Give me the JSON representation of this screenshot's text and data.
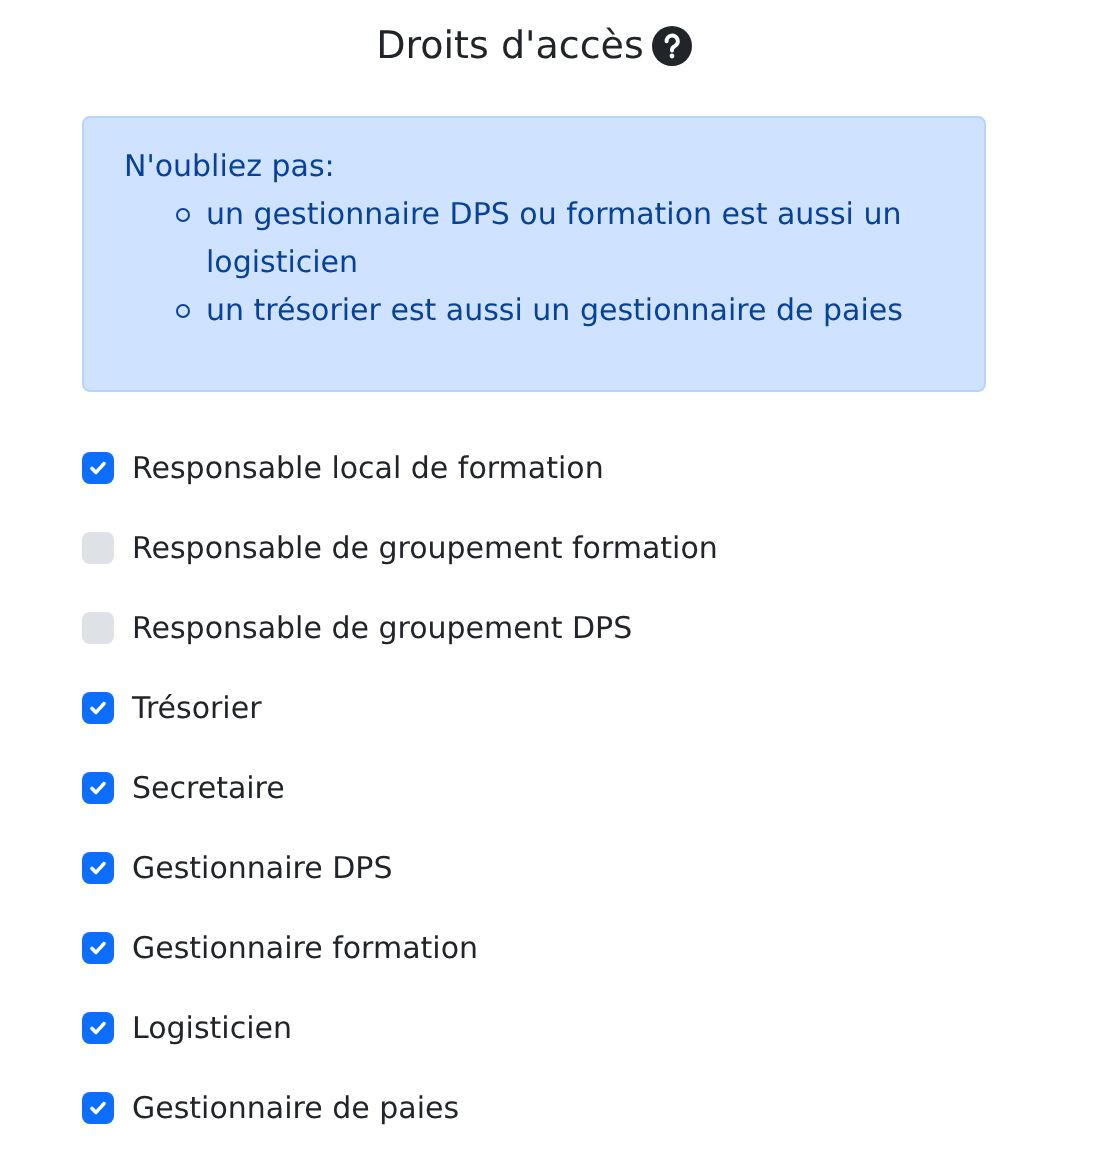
{
  "title": "Droits d'accès",
  "note": {
    "heading": "N'oubliez pas:",
    "items": [
      "un gestionnaire DPS ou formation est aussi un logisticien",
      "un trésorier est aussi un gestionnaire de paies"
    ]
  },
  "roles": [
    {
      "label": "Responsable local de formation",
      "checked": true
    },
    {
      "label": "Responsable de groupement formation",
      "checked": false
    },
    {
      "label": "Responsable de groupement DPS",
      "checked": false
    },
    {
      "label": "Trésorier",
      "checked": true
    },
    {
      "label": "Secretaire",
      "checked": true
    },
    {
      "label": "Gestionnaire DPS",
      "checked": true
    },
    {
      "label": "Gestionnaire formation",
      "checked": true
    },
    {
      "label": "Logisticien",
      "checked": true
    },
    {
      "label": "Gestionnaire de paies",
      "checked": true
    }
  ]
}
